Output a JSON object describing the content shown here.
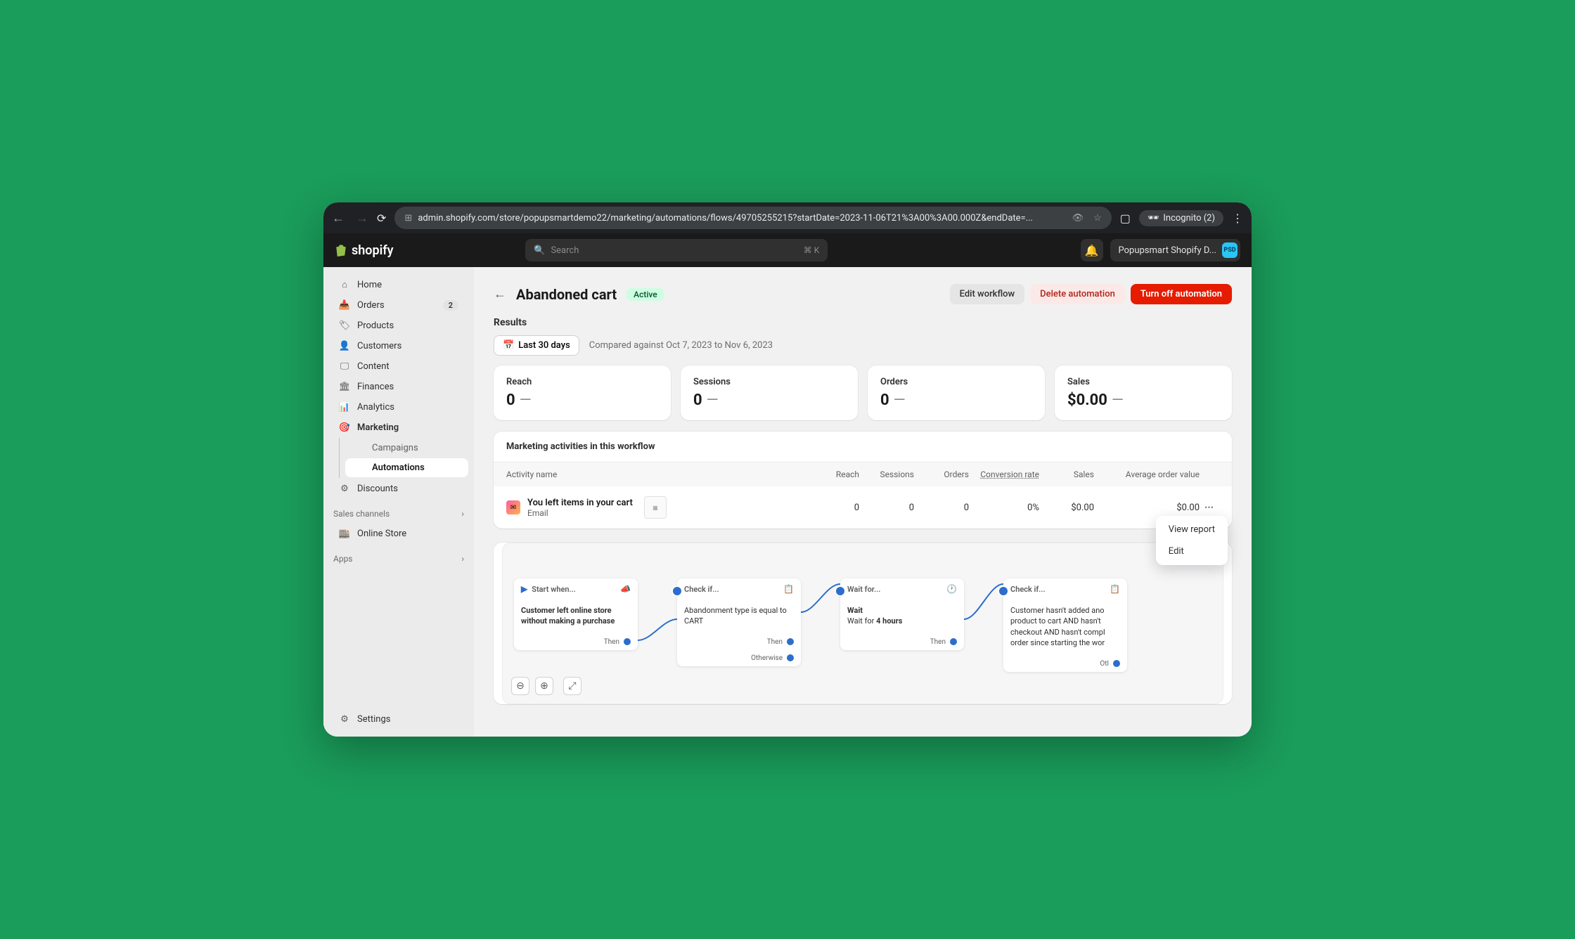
{
  "browser": {
    "url": "admin.shopify.com/store/popupsmartdemo22/marketing/automations/flows/49705255215?startDate=2023-11-06T21%3A00%3A00.000Z&endDate=...",
    "incognito_label": "Incognito (2)"
  },
  "header": {
    "logo_text": "shopify",
    "search_placeholder": "Search",
    "search_shortcut": "⌘ K",
    "account_label": "Popupsmart Shopify D...",
    "account_avatar": "PSD"
  },
  "sidebar": {
    "items": [
      {
        "label": "Home",
        "icon": "home"
      },
      {
        "label": "Orders",
        "icon": "orders",
        "badge": "2"
      },
      {
        "label": "Products",
        "icon": "products"
      },
      {
        "label": "Customers",
        "icon": "customers"
      },
      {
        "label": "Content",
        "icon": "content"
      },
      {
        "label": "Finances",
        "icon": "finances"
      },
      {
        "label": "Analytics",
        "icon": "analytics"
      },
      {
        "label": "Marketing",
        "icon": "marketing",
        "bold": true
      }
    ],
    "marketing_sub": [
      {
        "label": "Campaigns"
      },
      {
        "label": "Automations",
        "active": true
      }
    ],
    "discounts_label": "Discounts",
    "sales_channels_header": "Sales channels",
    "sales_channels": [
      {
        "label": "Online Store"
      }
    ],
    "apps_header": "Apps",
    "settings_label": "Settings"
  },
  "page": {
    "title": "Abandoned cart",
    "status": "Active",
    "actions": {
      "edit": "Edit workflow",
      "delete": "Delete automation",
      "turnoff": "Turn off automation"
    },
    "results_title": "Results",
    "date_range": "Last 30 days",
    "compared": "Compared against Oct 7, 2023 to Nov 6, 2023",
    "metrics": [
      {
        "label": "Reach",
        "value": "0"
      },
      {
        "label": "Sessions",
        "value": "0"
      },
      {
        "label": "Orders",
        "value": "0"
      },
      {
        "label": "Sales",
        "value": "$0.00"
      }
    ]
  },
  "activities": {
    "panel_title": "Marketing activities in this workflow",
    "columns": {
      "name": "Activity name",
      "reach": "Reach",
      "sessions": "Sessions",
      "orders": "Orders",
      "conversion": "Conversion rate",
      "sales": "Sales",
      "aov": "Average order value"
    },
    "rows": [
      {
        "title": "You left items in your cart",
        "subtitle": "Email",
        "reach": "0",
        "sessions": "0",
        "orders": "0",
        "conversion": "0%",
        "sales": "$0.00",
        "aov": "$0.00"
      }
    ],
    "dropdown": {
      "view": "View report",
      "edit": "Edit"
    }
  },
  "workflow": {
    "nodes": [
      {
        "head": "Start when...",
        "body_bold": "Customer left online store without making a purchase",
        "body": "",
        "then": "Then",
        "icon": "megaphone",
        "type": "start"
      },
      {
        "head": "Check if...",
        "body": "Abandonment type is equal to CART",
        "then": "Then",
        "otherwise": "Otherwise",
        "icon": "clipboard"
      },
      {
        "head": "Wait for...",
        "title": "Wait",
        "body": "Wait for 4 hours",
        "then": "Then",
        "icon": "clock"
      },
      {
        "head": "Check if...",
        "body": "Customer hasn't added ano product to cart AND hasn't checkout AND hasn't compl order since starting the wor",
        "otherwise": "Otl",
        "icon": "clipboard"
      }
    ]
  }
}
